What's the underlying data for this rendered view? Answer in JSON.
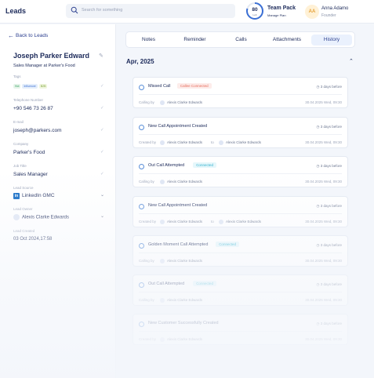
{
  "header": {
    "brand": "Leads",
    "search_placeholder": "Search for something",
    "gauge_value": "80",
    "gauge_unit": "Left",
    "team_title": "Team Pack",
    "team_sub": "Manage Plan",
    "avatar_initials": "AA",
    "user_name": "Anna Adamo",
    "user_role": "Founder"
  },
  "lead": {
    "back_label": "Back to Leads",
    "name": "Joseph Parker Edward",
    "title": "Sales Manager at Parker's Food",
    "tags_label": "Tags",
    "tags": [
      "Hot",
      "Influencer",
      "B2B"
    ],
    "phone_label": "Telephone Number",
    "phone": "+90 546 73 26 87",
    "email_label": "E-mail",
    "email": "joseph@parkers.com",
    "company_label": "Company",
    "company": "Parker's Food",
    "jobtitle_label": "Job Title",
    "jobtitle": "Sales Manager",
    "source_label": "Lead Source",
    "source": "LinkedIn GMC",
    "owner_label": "Lead Owner",
    "owner": "Alexis Clarke Edwards",
    "created_label": "Lead Created",
    "created": "03 Oct 2024,17:58"
  },
  "tabs": [
    "Notes",
    "Reminder",
    "Calls",
    "Attachments",
    "History"
  ],
  "history": {
    "month": "Apr, 2025",
    "items": [
      {
        "title": "Missed Call",
        "badge": "Callee Connected",
        "time": "3 days before",
        "by": "Calling by",
        "who": "Alexis Clarke Edwards",
        "to": "",
        "who2": "",
        "date": "30.04.2025 Wed, 09:30"
      },
      {
        "title": "New Call Appointment Created",
        "badge": "",
        "time": "3 days before",
        "by": "Created by",
        "who": "Alexis Clarke Edwards",
        "to": "to",
        "who2": "Alexis Clarke Edwards",
        "date": "30.04.2025 Wed, 09:30"
      },
      {
        "title": "Out Call Attempted",
        "badge": "Connected",
        "time": "3 days before",
        "by": "Calling by",
        "who": "Alexis Clarke Edwards",
        "to": "",
        "who2": "",
        "date": "30.04.2025 Wed, 09:30"
      },
      {
        "title": "New Call Appointment Created",
        "badge": "",
        "time": "3 days before",
        "by": "Created by",
        "who": "Alexis Clarke Edwards",
        "to": "to",
        "who2": "Alexis Clarke Edwards",
        "date": "30.04.2025 Wed, 09:30"
      },
      {
        "title": "Golden Moment Call Attempted",
        "badge": "Connected",
        "time": "3 days before",
        "by": "Calling by",
        "who": "Alexis Clarke Edwards",
        "to": "",
        "who2": "",
        "date": "30.04.2025 Wed, 09:30"
      },
      {
        "title": "Out Call Attempted",
        "badge": "Connected",
        "time": "3 days before",
        "by": "Calling by",
        "who": "Alexis Clarke Edwards",
        "to": "",
        "who2": "",
        "date": "30.04.2025 Wed, 09:30"
      },
      {
        "title": "New Customer Successfully Created",
        "badge": "",
        "time": "3 days before",
        "by": "Created by",
        "who": "Alexis Clarke Edwards",
        "to": "",
        "who2": "",
        "date": "30.04.2025 Wed, 09:30"
      }
    ]
  },
  "colors": {
    "missed_badge_bg": "#fdecea",
    "missed_badge_fg": "#e66b5b",
    "connected_badge_bg": "#e6f7fb",
    "connected_badge_fg": "#36b3cf",
    "accent": "#2b3f8f"
  }
}
